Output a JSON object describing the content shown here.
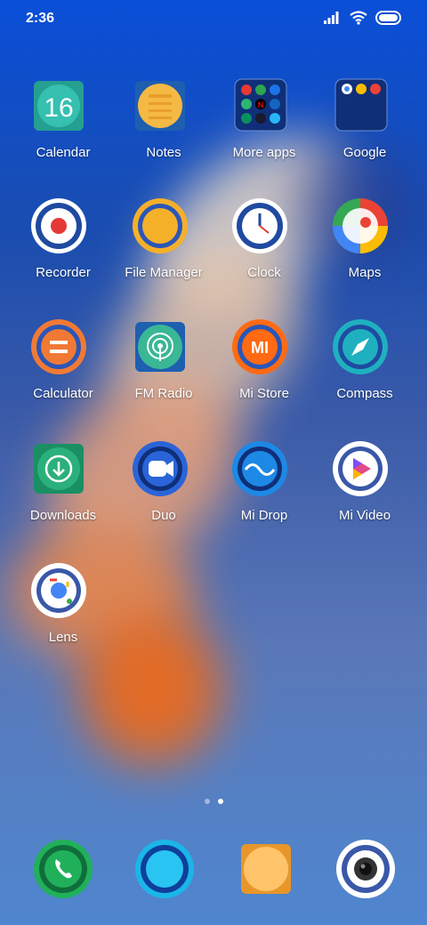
{
  "status": {
    "time": "2:36",
    "icons": [
      "signal-icon",
      "wifi-icon",
      "battery-icon"
    ]
  },
  "apps": [
    {
      "label": "Calendar",
      "icon": "calendar-icon",
      "badge_text": "16"
    },
    {
      "label": "Notes",
      "icon": "notes-icon"
    },
    {
      "label": "More apps",
      "icon": "folder-icon"
    },
    {
      "label": "Google",
      "icon": "folder-icon"
    },
    {
      "label": "Recorder",
      "icon": "recorder-icon"
    },
    {
      "label": "File Manager",
      "icon": "file-manager-icon"
    },
    {
      "label": "Clock",
      "icon": "clock-icon"
    },
    {
      "label": "Maps",
      "icon": "maps-icon"
    },
    {
      "label": "Calculator",
      "icon": "calculator-icon"
    },
    {
      "label": "FM Radio",
      "icon": "radio-icon"
    },
    {
      "label": "Mi Store",
      "icon": "mi-store-icon",
      "badge_text": "MI"
    },
    {
      "label": "Compass",
      "icon": "compass-icon"
    },
    {
      "label": "Downloads",
      "icon": "download-icon"
    },
    {
      "label": "Duo",
      "icon": "video-call-icon"
    },
    {
      "label": "Mi Drop",
      "icon": "mi-drop-icon"
    },
    {
      "label": "Mi Video",
      "icon": "video-play-icon"
    },
    {
      "label": "Lens",
      "icon": "lens-icon"
    }
  ],
  "page_indicator": {
    "count": 2,
    "active": 2
  },
  "dock": [
    {
      "icon": "phone-icon"
    },
    {
      "icon": "messages-icon"
    },
    {
      "icon": "browser-icon"
    },
    {
      "icon": "camera-icon"
    }
  ],
  "colors": {
    "wallpaper_top": "#0a4fd8",
    "wallpaper_bottom": "#4f86cf",
    "rocket_orange": "#f07a2a"
  }
}
